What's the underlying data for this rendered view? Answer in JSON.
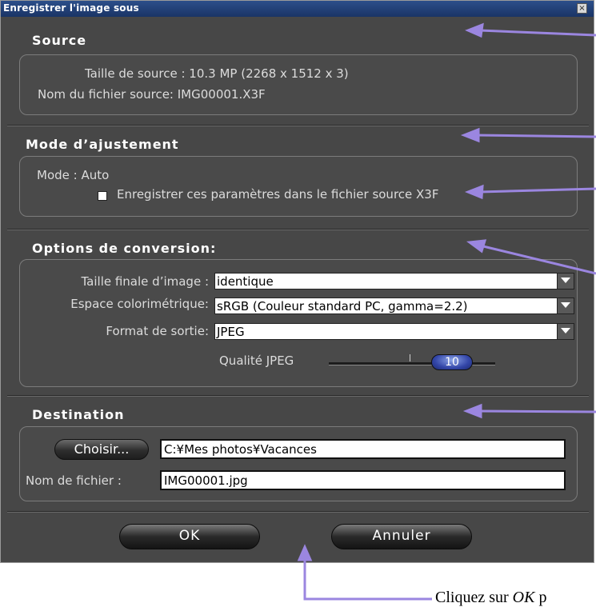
{
  "window": {
    "title": "Enregistrer l'image sous",
    "close_label": "×"
  },
  "source": {
    "title": "Source",
    "size_label": "Taille de source : 10.3 MP (2268 x 1512 x 3)",
    "file_label": "Nom du fichier source:  IMG00001.X3F"
  },
  "adjust": {
    "title": "Mode d’ajustement",
    "mode_label": "Mode : Auto",
    "save_params_label": "Enregistrer ces paramètres dans le fichier source X3F"
  },
  "conversion": {
    "title": "Options de conversion:",
    "size_label": "Taille finale d’image :",
    "size_value": "identique",
    "colorspace_label": "Espace colorimétrique:",
    "colorspace_value": "sRGB (Couleur standard PC, gamma=2.2)",
    "format_label": "Format de sortie:",
    "format_value": "JPEG",
    "quality_label": "Qualité  JPEG",
    "quality_value": "10"
  },
  "destination": {
    "title": "Destination",
    "choose_label": "Choisir...",
    "path_value": "C:¥Mes photos¥Vacances",
    "filename_label": "Nom de fichier :",
    "filename_value": "IMG00001.jpg"
  },
  "buttons": {
    "ok_label": "OK",
    "cancel_label": "Annuler"
  },
  "annotation": {
    "caption_prefix": "Cliquez sur ",
    "caption_em": "OK",
    "caption_suffix": " p",
    "arrow_color": "#9b86e0"
  }
}
